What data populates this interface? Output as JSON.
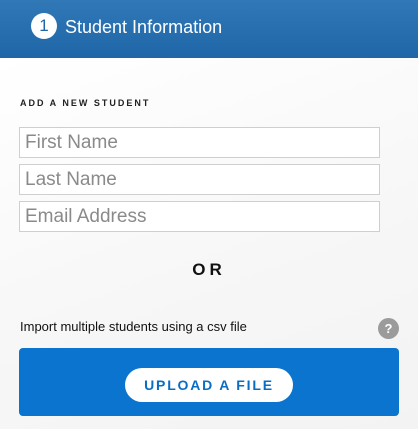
{
  "header": {
    "step_number": "1",
    "title": "Student Information"
  },
  "add_student": {
    "section_label": "ADD A NEW STUDENT",
    "first_name_placeholder": "First Name",
    "last_name_placeholder": "Last Name",
    "email_placeholder": "Email Address"
  },
  "divider": {
    "or_label": "OR"
  },
  "import": {
    "description": "Import multiple students using a csv file",
    "help_icon": "question-mark-icon",
    "help_label": "?",
    "upload_label": "UPLOAD A FILE"
  },
  "colors": {
    "header_blue": "#1f66a8",
    "upload_panel_blue": "#0a74cf",
    "help_gray": "#9b9b9b"
  }
}
